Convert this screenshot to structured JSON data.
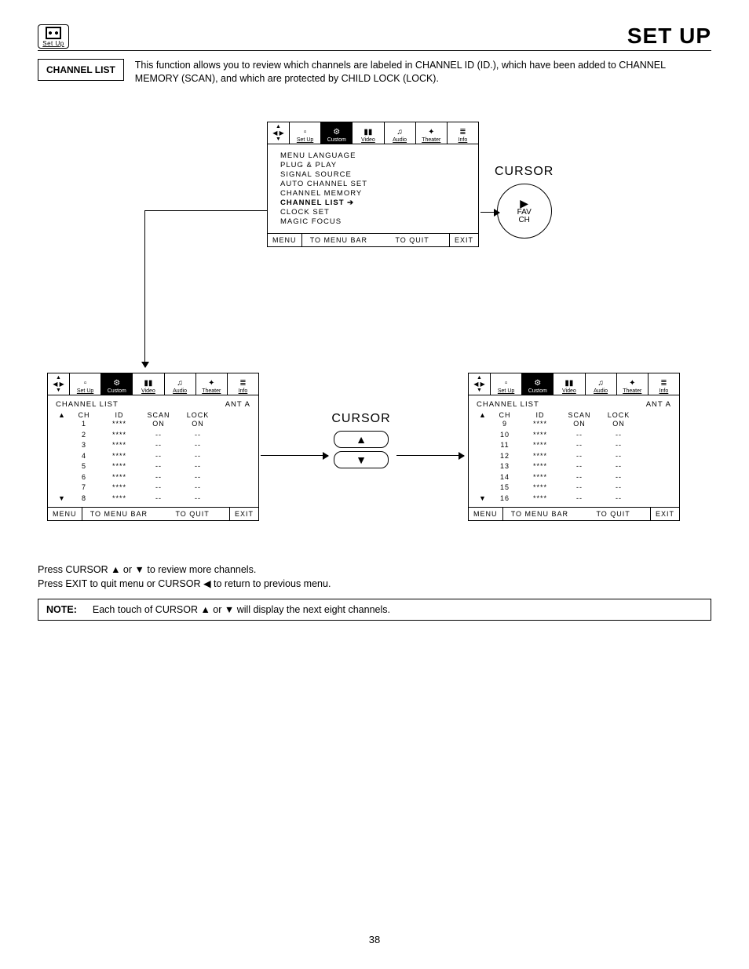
{
  "header": {
    "iconLabel": "Set Up",
    "pageTitle": "SET UP"
  },
  "intro": {
    "label": "CHANNEL LIST",
    "text": "This function allows you to review which channels are labeled in CHANNEL ID (ID.), which have been added to CHANNEL MEMORY (SCAN), and which are protected by CHILD LOCK (LOCK)."
  },
  "menuTabs": [
    "Set Up",
    "Custom",
    "Video",
    "Audio",
    "Theater",
    "Info"
  ],
  "mainMenu": {
    "items": [
      "MENU LANGUAGE",
      "PLUG & PLAY",
      "SIGNAL SOURCE",
      "AUTO CHANNEL SET",
      "CHANNEL MEMORY",
      "CHANNEL LIST",
      "CLOCK SET",
      "MAGIC FOCUS"
    ],
    "selectedIndex": 5,
    "foot": {
      "menu": "MENU",
      "toMenuBar": "TO MENU BAR",
      "toQuit": "TO QUIT",
      "exit": "EXIT"
    }
  },
  "cursorRight": {
    "title": "CURSOR",
    "arrow": "▶",
    "l1": "FAV",
    "l2": "CH"
  },
  "channelList1": {
    "title": "CHANNEL LIST",
    "ant": "ANT A",
    "headers": {
      "ch": "CH",
      "id": "ID",
      "scan": "SCAN",
      "lock": "LOCK"
    },
    "rows": [
      {
        "ch": "1",
        "id": "****",
        "scan": "ON",
        "lock": "ON"
      },
      {
        "ch": "2",
        "id": "****",
        "scan": "--",
        "lock": "--"
      },
      {
        "ch": "3",
        "id": "****",
        "scan": "--",
        "lock": "--"
      },
      {
        "ch": "4",
        "id": "****",
        "scan": "--",
        "lock": "--"
      },
      {
        "ch": "5",
        "id": "****",
        "scan": "--",
        "lock": "--"
      },
      {
        "ch": "6",
        "id": "****",
        "scan": "--",
        "lock": "--"
      },
      {
        "ch": "7",
        "id": "****",
        "scan": "--",
        "lock": "--"
      },
      {
        "ch": "8",
        "id": "****",
        "scan": "--",
        "lock": "--"
      }
    ],
    "foot": {
      "menu": "MENU",
      "toMenuBar": "TO MENU BAR",
      "toQuit": "TO QUIT",
      "exit": "EXIT"
    }
  },
  "cursorUpDown": {
    "title": "CURSOR",
    "up": "▲",
    "down": "▼"
  },
  "channelList2": {
    "title": "CHANNEL LIST",
    "ant": "ANT A",
    "headers": {
      "ch": "CH",
      "id": "ID",
      "scan": "SCAN",
      "lock": "LOCK"
    },
    "rows": [
      {
        "ch": "9",
        "id": "****",
        "scan": "ON",
        "lock": "ON"
      },
      {
        "ch": "10",
        "id": "****",
        "scan": "--",
        "lock": "--"
      },
      {
        "ch": "11",
        "id": "****",
        "scan": "--",
        "lock": "--"
      },
      {
        "ch": "12",
        "id": "****",
        "scan": "--",
        "lock": "--"
      },
      {
        "ch": "13",
        "id": "****",
        "scan": "--",
        "lock": "--"
      },
      {
        "ch": "14",
        "id": "****",
        "scan": "--",
        "lock": "--"
      },
      {
        "ch": "15",
        "id": "****",
        "scan": "--",
        "lock": "--"
      },
      {
        "ch": "16",
        "id": "****",
        "scan": "--",
        "lock": "--"
      }
    ],
    "foot": {
      "menu": "MENU",
      "toMenuBar": "TO MENU BAR",
      "toQuit": "TO QUIT",
      "exit": "EXIT"
    }
  },
  "bodyText": {
    "line1": "Press CURSOR ▲ or ▼ to review more channels.",
    "line2": "Press EXIT to quit menu or CURSOR ◀ to return to previous menu."
  },
  "note": {
    "label": "NOTE:",
    "text": "Each touch of CURSOR ▲ or ▼ will display the next eight channels."
  },
  "pageNumber": "38"
}
